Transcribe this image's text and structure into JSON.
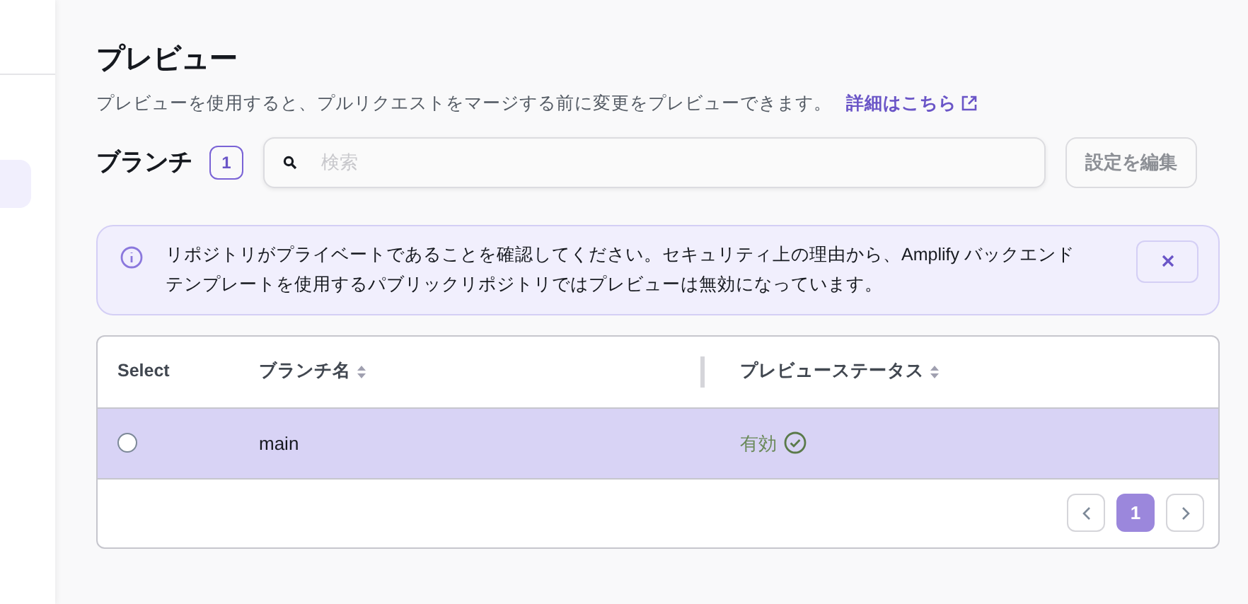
{
  "sidebar": {
    "items": [
      {
        "selected": true
      }
    ]
  },
  "page": {
    "title": "プレビュー",
    "description": "プレビューを使用すると、プルリクエストをマージする前に変更をプレビューできます。",
    "learn_more_link": "詳細はこちら"
  },
  "branches": {
    "heading": "ブランチ",
    "count": "1",
    "search": {
      "placeholder": "検索"
    },
    "edit_button": "設定を編集"
  },
  "alert": {
    "message": "リポジトリがプライベートであることを確認してください。セキュリティ上の理由から、Amplify バックエンドテンプレートを使用するパブリックリポジトリではプレビューは無効になっています。"
  },
  "table": {
    "columns": [
      "Select",
      "ブランチ名",
      "プレビューステータス"
    ],
    "rows": [
      {
        "selected": false,
        "highlighted": true,
        "branch": "main",
        "status": "有効",
        "kind": "enabled"
      }
    ]
  },
  "pagination": {
    "pages": [
      {
        "label": "1",
        "selected": true
      }
    ]
  }
}
